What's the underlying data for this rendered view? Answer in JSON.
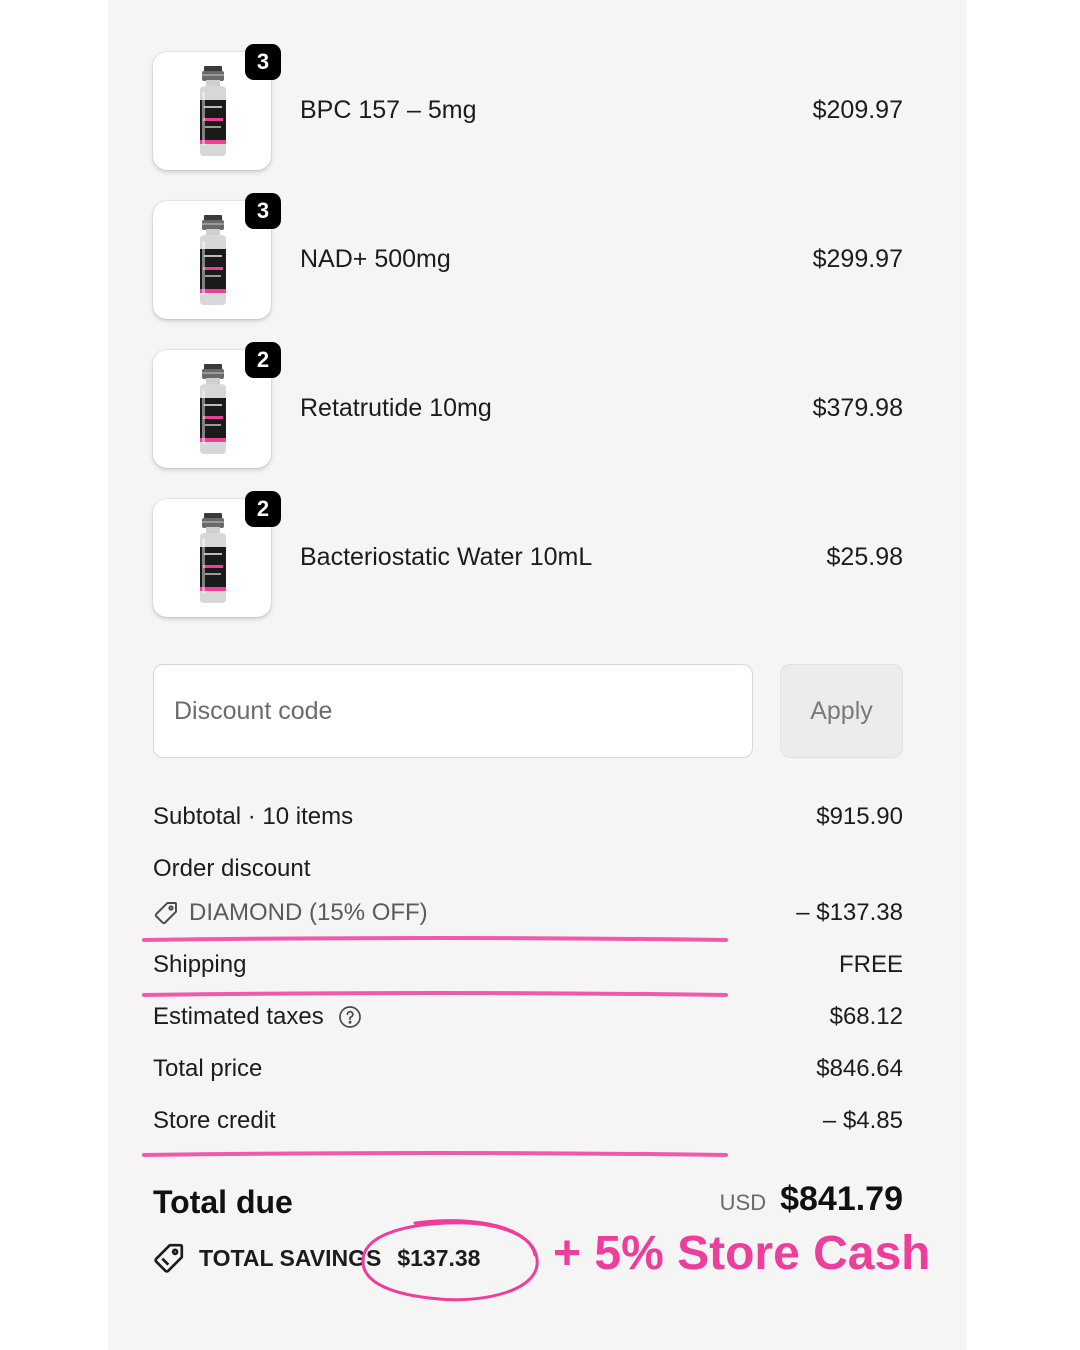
{
  "colors": {
    "accent_pink": "#ee3e9b",
    "panel_bg": "#f5f5f5",
    "badge_bg": "#000000",
    "text": "#1c1c1c",
    "muted": "#6b6b6b"
  },
  "cart": {
    "items": [
      {
        "name": "BPC 157 – 5mg",
        "quantity": "3",
        "price": "$209.97",
        "image_icon": "vial-icon"
      },
      {
        "name": "NAD+ 500mg",
        "quantity": "3",
        "price": "$299.97",
        "image_icon": "vial-icon"
      },
      {
        "name": "Retatrutide 10mg",
        "quantity": "2",
        "price": "$379.98",
        "image_icon": "vial-icon"
      },
      {
        "name": "Bacteriostatic Water 10mL",
        "quantity": "2",
        "price": "$25.98",
        "image_icon": "vial-icon"
      }
    ]
  },
  "discount": {
    "placeholder": "Discount code",
    "apply_label": "Apply"
  },
  "summary": {
    "subtotal_label": "Subtotal · 10 items",
    "subtotal_value": "$915.90",
    "order_discount_label": "Order discount",
    "discount_code_label": "DIAMOND (15% OFF)",
    "discount_value": "– $137.38",
    "shipping_label": "Shipping",
    "shipping_value": "FREE",
    "taxes_label": "Estimated taxes",
    "taxes_value": "$68.12",
    "total_price_label": "Total price",
    "total_price_value": "$846.64",
    "store_credit_label": "Store credit",
    "store_credit_value": "– $4.85",
    "total_due_label": "Total due",
    "currency": "USD",
    "total_due_value": "$841.79",
    "savings_label": "TOTAL SAVINGS",
    "savings_value": "$137.38"
  },
  "promo": {
    "store_cash_text": "+ 5% Store Cash"
  }
}
